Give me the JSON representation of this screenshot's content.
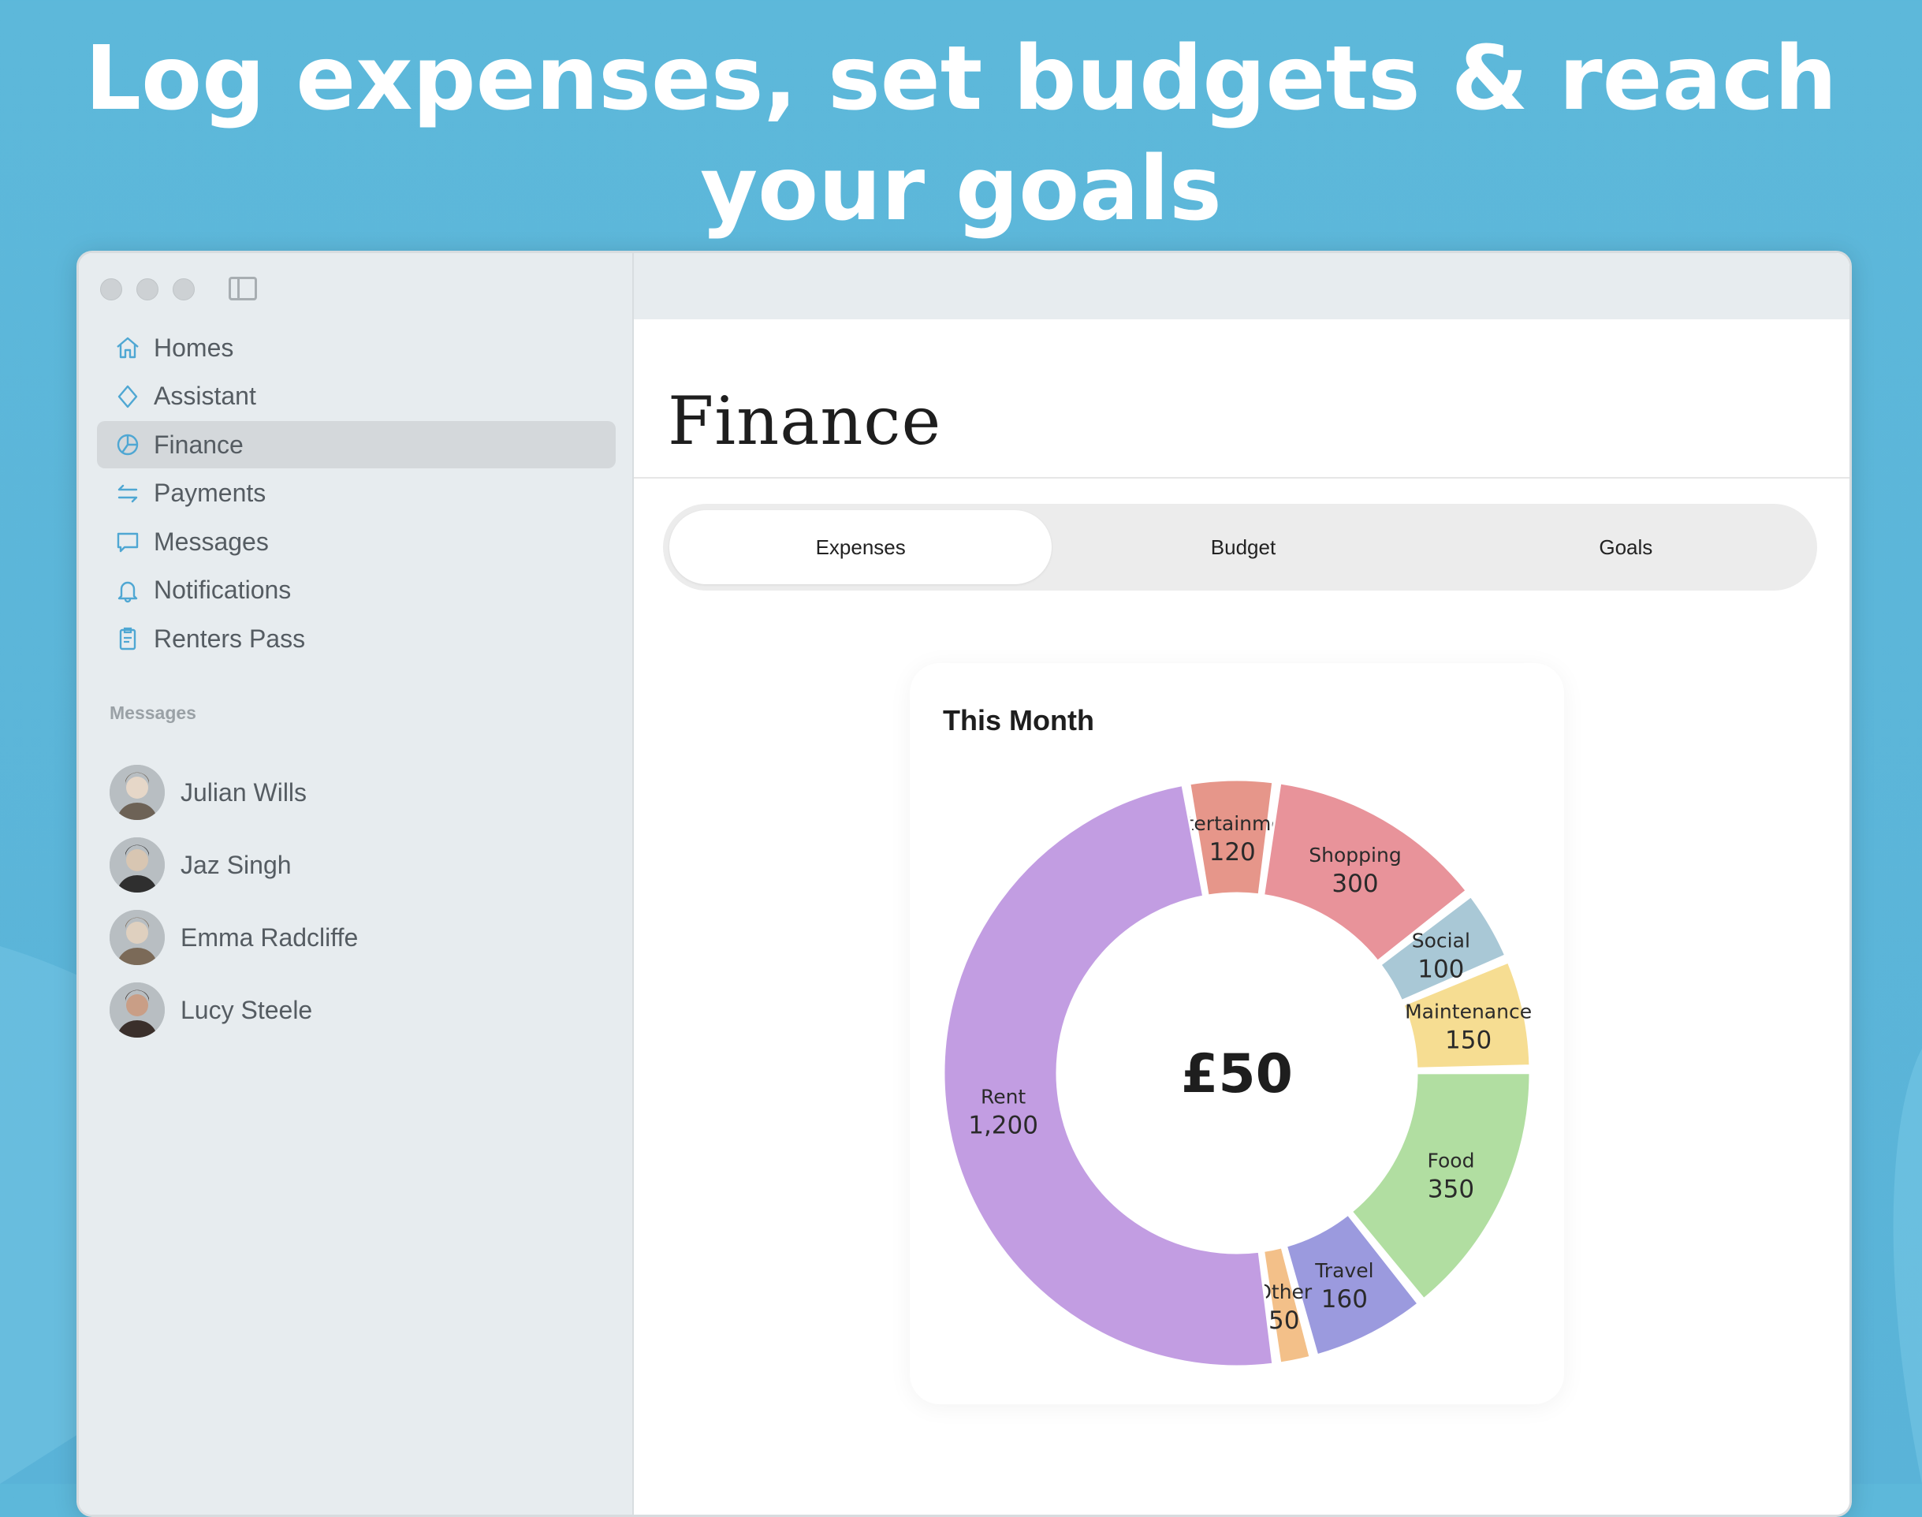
{
  "headline": "Log expenses, set budgets & reach your goals",
  "sidebar": {
    "nav": [
      {
        "label": "Homes",
        "icon": "home-icon"
      },
      {
        "label": "Assistant",
        "icon": "diamond-icon"
      },
      {
        "label": "Finance",
        "icon": "pie-chart-icon",
        "active": true
      },
      {
        "label": "Payments",
        "icon": "transfer-arrows-icon"
      },
      {
        "label": "Messages",
        "icon": "chat-bubble-icon"
      },
      {
        "label": "Notifications",
        "icon": "bell-icon"
      },
      {
        "label": "Renters Pass",
        "icon": "clipboard-icon"
      }
    ],
    "messages_label": "Messages",
    "contacts": [
      {
        "name": "Julian Wills"
      },
      {
        "name": "Jaz Singh"
      },
      {
        "name": "Emma Radcliffe"
      },
      {
        "name": "Lucy Steele"
      }
    ]
  },
  "main": {
    "title": "Finance",
    "tabs": [
      {
        "label": "Expenses",
        "active": true
      },
      {
        "label": "Budget"
      },
      {
        "label": "Goals"
      }
    ],
    "card_title": "This Month",
    "center_total": "£50"
  },
  "colors": {
    "accent": "#5ab3d8",
    "icon": "#4fa7d3"
  },
  "chart_data": {
    "type": "pie",
    "title": "This Month",
    "categories": [
      "Entertainment",
      "Shopping",
      "Social",
      "Maintenance",
      "Food",
      "Travel",
      "Other",
      "Rent"
    ],
    "values": [
      120,
      300,
      100,
      150,
      350,
      160,
      50,
      1200
    ],
    "value_labels": [
      "120",
      "300",
      "100",
      "150",
      "350",
      "160",
      "50",
      "1,200"
    ],
    "colors": [
      "#e6968a",
      "#e8939a",
      "#a9c8d6",
      "#f6dd92",
      "#b1dea1",
      "#9b9ade",
      "#f3c089",
      "#c29de2"
    ]
  }
}
